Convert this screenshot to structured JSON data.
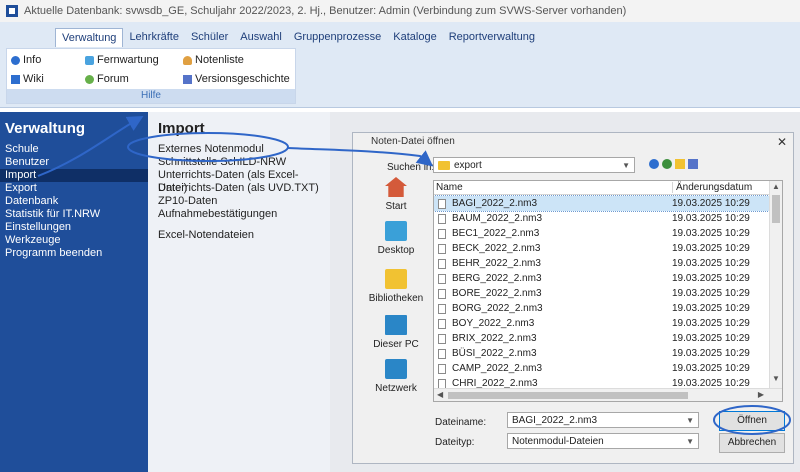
{
  "window": {
    "title": "Aktuelle Datenbank: svwsdb_GE, Schuljahr 2022/2023, 2. Hj., Benutzer: Admin (Verbindung zum SVWS-Server vorhanden)"
  },
  "ribbon": {
    "tabs": [
      "Verwaltung",
      "Lehrkräfte",
      "Schüler",
      "Auswahl",
      "Gruppenprozesse",
      "Kataloge",
      "Reportverwaltung"
    ],
    "items": {
      "info": "Info",
      "wiki": "Wiki",
      "fernwartung": "Fernwartung",
      "forum": "Forum",
      "notenliste": "Notenliste",
      "versionsgeschichte": "Versionsgeschichte"
    },
    "group_label": "Hilfe"
  },
  "leftnav": {
    "title": "Verwaltung",
    "items": [
      "Schule",
      "Benutzer",
      "Import",
      "Export",
      "Datenbank",
      "Statistik für IT.NRW",
      "Einstellungen",
      "Werkzeuge",
      "Programm beenden"
    ]
  },
  "midpanel": {
    "title": "Import",
    "items": [
      "Externes Notenmodul",
      "Schnittstelle SchILD-NRW",
      "Unterrichts-Daten (als Excel-Datei)",
      "Unterrichts-Daten (als UVD.TXT)",
      "ZP10-Daten",
      "Aufnahmebestätigungen"
    ],
    "extra": "Excel-Notendateien"
  },
  "dialog": {
    "title": "Noten-Datei öffnen",
    "close": "✕",
    "suchen_label": "Suchen in:",
    "folder": "export",
    "places": [
      "Start",
      "Desktop",
      "Bibliotheken",
      "Dieser PC",
      "Netzwerk"
    ],
    "columns": {
      "name": "Name",
      "date": "Änderungsdatum"
    },
    "files": [
      {
        "name": "BAGI_2022_2.nm3",
        "date": "19.03.2025 10:29"
      },
      {
        "name": "BAUM_2022_2.nm3",
        "date": "19.03.2025 10:29"
      },
      {
        "name": "BEC1_2022_2.nm3",
        "date": "19.03.2025 10:29"
      },
      {
        "name": "BECK_2022_2.nm3",
        "date": "19.03.2025 10:29"
      },
      {
        "name": "BEHR_2022_2.nm3",
        "date": "19.03.2025 10:29"
      },
      {
        "name": "BERG_2022_2.nm3",
        "date": "19.03.2025 10:29"
      },
      {
        "name": "BORE_2022_2.nm3",
        "date": "19.03.2025 10:29"
      },
      {
        "name": "BORG_2022_2.nm3",
        "date": "19.03.2025 10:29"
      },
      {
        "name": "BOY_2022_2.nm3",
        "date": "19.03.2025 10:29"
      },
      {
        "name": "BRIX_2022_2.nm3",
        "date": "19.03.2025 10:29"
      },
      {
        "name": "BÜSI_2022_2.nm3",
        "date": "19.03.2025 10:29"
      },
      {
        "name": "CAMP_2022_2.nm3",
        "date": "19.03.2025 10:29"
      },
      {
        "name": "CHRI_2022_2.nm3",
        "date": "19.03.2025 10:29"
      }
    ],
    "dateiname_label": "Dateiname:",
    "dateiname_value": "BAGI_2022_2.nm3",
    "dateityp_label": "Dateityp:",
    "dateityp_value": "Notenmodul-Dateien",
    "open_button": "Öffnen",
    "cancel_button": "Abbrechen"
  }
}
